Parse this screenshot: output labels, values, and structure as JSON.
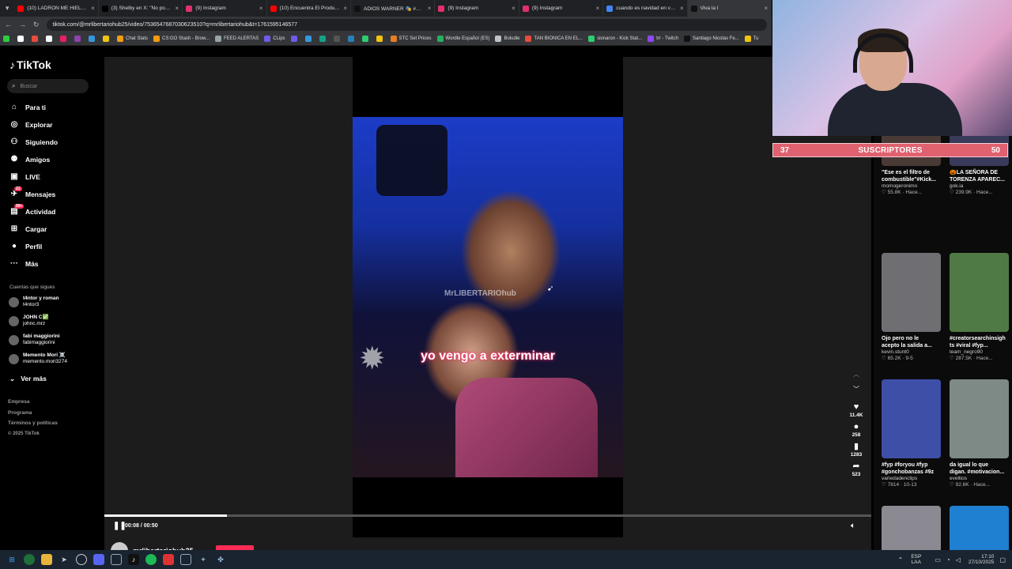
{
  "browser": {
    "tabs": [
      {
        "title": "(10) LADRÓN ME HIELA LA SA",
        "color": "#ff0000",
        "icon": "youtube-icon"
      },
      {
        "title": "(3) Shelby en X: \"No podrán t",
        "color": "#000000",
        "icon": "x-icon"
      },
      {
        "title": "(9) Instagram",
        "color": "#e1306c",
        "icon": "instagram-icon"
      },
      {
        "title": "(10) Encuentra El Producto Fa",
        "color": "#ff0000",
        "icon": "youtube-icon"
      },
      {
        "title": "ADIOS WARNER 🎭 #mrrelm",
        "color": "#111111",
        "icon": "tiktok-icon"
      },
      {
        "title": "(9) Instagram",
        "color": "#e1306c",
        "icon": "instagram-icon"
      },
      {
        "title": "(9) Instagram",
        "color": "#e1306c",
        "icon": "instagram-icon"
      },
      {
        "title": "cuando es navidad en venezu",
        "color": "#4285f4",
        "icon": "google-icon"
      },
      {
        "title": "Viva la l",
        "color": "#111111",
        "icon": "tiktok-icon"
      }
    ],
    "url": "tiktok.com/@mrlibertariohub25/video/7536547687030623510?q=mrlibertariohub&t=1761595146577",
    "bookmarks": [
      {
        "label": "",
        "color": "#2ecc40"
      },
      {
        "label": "",
        "color": "#ffffff"
      },
      {
        "label": "",
        "color": "#e74c3c"
      },
      {
        "label": "",
        "color": "#ffffff"
      },
      {
        "label": "",
        "color": "#e91e63"
      },
      {
        "label": "",
        "color": "#8e44ad"
      },
      {
        "label": "",
        "color": "#3498db"
      },
      {
        "label": "",
        "color": "#f1c40f"
      },
      {
        "label": "Chat Stats",
        "color": "#f39c12"
      },
      {
        "label": "CS:GO Stash - Brow...",
        "color": "#f39c12"
      },
      {
        "label": "FEED ALERTAS",
        "color": "#95a5a6"
      },
      {
        "label": "CLips",
        "color": "#6c5ce7"
      },
      {
        "label": "",
        "color": "#6c5ce7"
      },
      {
        "label": "",
        "color": "#3498db"
      },
      {
        "label": "",
        "color": "#16a085"
      },
      {
        "label": "",
        "color": "#555555"
      },
      {
        "label": "",
        "color": "#2980b9"
      },
      {
        "label": "",
        "color": "#2ecc71"
      },
      {
        "label": "",
        "color": "#f1c40f"
      },
      {
        "label": "STC Set Prices",
        "color": "#e67e22"
      },
      {
        "label": "Wordle Español (ES)",
        "color": "#27ae60"
      },
      {
        "label": "Boludle",
        "color": "#bdc3c7"
      },
      {
        "label": "TAN BIONICA EN EL...",
        "color": "#e74c3c"
      },
      {
        "label": "sionaron - Kick Stat...",
        "color": "#2ecc71"
      },
      {
        "label": "trr - Twitch",
        "color": "#9146ff"
      },
      {
        "label": "Santiago Nicolas Fe...",
        "color": "#111111"
      },
      {
        "label": "Tu",
        "color": "#f1c40f"
      }
    ]
  },
  "tiktok": {
    "logo": "TikTok",
    "search_placeholder": "Buscar",
    "nav": [
      {
        "label": "Para ti",
        "icon": "home-icon",
        "glyph": "⌂",
        "badge": ""
      },
      {
        "label": "Explorar",
        "icon": "compass-icon",
        "glyph": "◎",
        "badge": ""
      },
      {
        "label": "Siguiendo",
        "icon": "following-icon",
        "glyph": "⚇",
        "badge": ""
      },
      {
        "label": "Amigos",
        "icon": "friends-icon",
        "glyph": "⚉",
        "badge": ""
      },
      {
        "label": "LIVE",
        "icon": "live-icon",
        "glyph": "▣",
        "badge": ""
      },
      {
        "label": "Mensajes",
        "icon": "messages-icon",
        "glyph": "✈",
        "badge": "23"
      },
      {
        "label": "Actividad",
        "icon": "activity-icon",
        "glyph": "▤",
        "badge": "99+"
      },
      {
        "label": "Cargar",
        "icon": "upload-icon",
        "glyph": "⊞",
        "badge": ""
      },
      {
        "label": "Perfil",
        "icon": "profile-icon",
        "glyph": "●",
        "badge": ""
      },
      {
        "label": "Más",
        "icon": "more-icon",
        "glyph": "···",
        "badge": ""
      }
    ],
    "following_title": "Cuentas que sigues",
    "following": [
      {
        "name": "t4ntor y roman",
        "handle": "t4ntor3"
      },
      {
        "name": "JOHN C✅",
        "handle": "johnc.mrz"
      },
      {
        "name": "fabi maggiorini",
        "handle": "fabimaggiorini"
      },
      {
        "name": "Memento Mori ☠️",
        "handle": "memento.mori3274"
      }
    ],
    "ver_mas": "Ver más",
    "footer": [
      "Empresa",
      "Programa",
      "Términos y políticas",
      "© 2025 TikTok"
    ]
  },
  "video": {
    "watermark": "MrLIBERTARIOhub",
    "subtitle": "yo vengo a exterminar",
    "time": "00:08 / 00:50",
    "progress": 0.16,
    "author": "mrlibertariohub25",
    "actions": [
      {
        "icon": "heart-icon",
        "glyph": "♥",
        "count": "11.4K"
      },
      {
        "icon": "comment-icon",
        "glyph": "●",
        "count": "258"
      },
      {
        "icon": "bookmark-icon",
        "glyph": "▮",
        "count": "1283"
      },
      {
        "icon": "share-icon",
        "glyph": "➦",
        "count": "523"
      }
    ]
  },
  "related": [
    {
      "title": "\"Ese es el filtro de\ncombustible\"#Kick...",
      "user": "momogeronimo",
      "meta": "♡ 55.8K · Hace...",
      "color": "#4a3a36"
    },
    {
      "title": "🎃LA SEÑORA DE\nTORENZA APAREC...",
      "user": "gok.ia",
      "meta": "♡ 239.9K · Hace...",
      "color": "#3a3a5a"
    },
    {
      "title": "Ojo pero no le\nacepto la salida a...",
      "user": "kevin.stunt0",
      "meta": "♡ 65.2K · 9-5",
      "color": "#6f6f73"
    },
    {
      "title": "#creatorsearchinsigh\nts #viral #fyp...",
      "user": "team_negro90",
      "meta": "♡ 287.5K · Hace...",
      "color": "#4f7a45"
    },
    {
      "title": "#fyp #foryou #fyp\n#gonchobanzas #9z",
      "user": "variedadenclips",
      "meta": "♡ 7814 · 10-13",
      "color": "#3e4fa8"
    },
    {
      "title": "da igual lo que\ndigan. #motivacion...",
      "user": "eveltios",
      "meta": "♡ 92.6K · Hace...",
      "color": "#7d8a86"
    },
    {
      "title": "",
      "user": "",
      "meta": "",
      "color": "#8b8a93"
    },
    {
      "title": "",
      "user": "",
      "meta": "",
      "color": "#1f7fd0"
    }
  ],
  "stream": {
    "sub_goal": {
      "current": "37",
      "label": "SUSCRIPTORES",
      "target": "50"
    }
  },
  "taskbar": {
    "lang": "ESP\nLAA",
    "time": "17:10",
    "date": "27/10/2025"
  }
}
